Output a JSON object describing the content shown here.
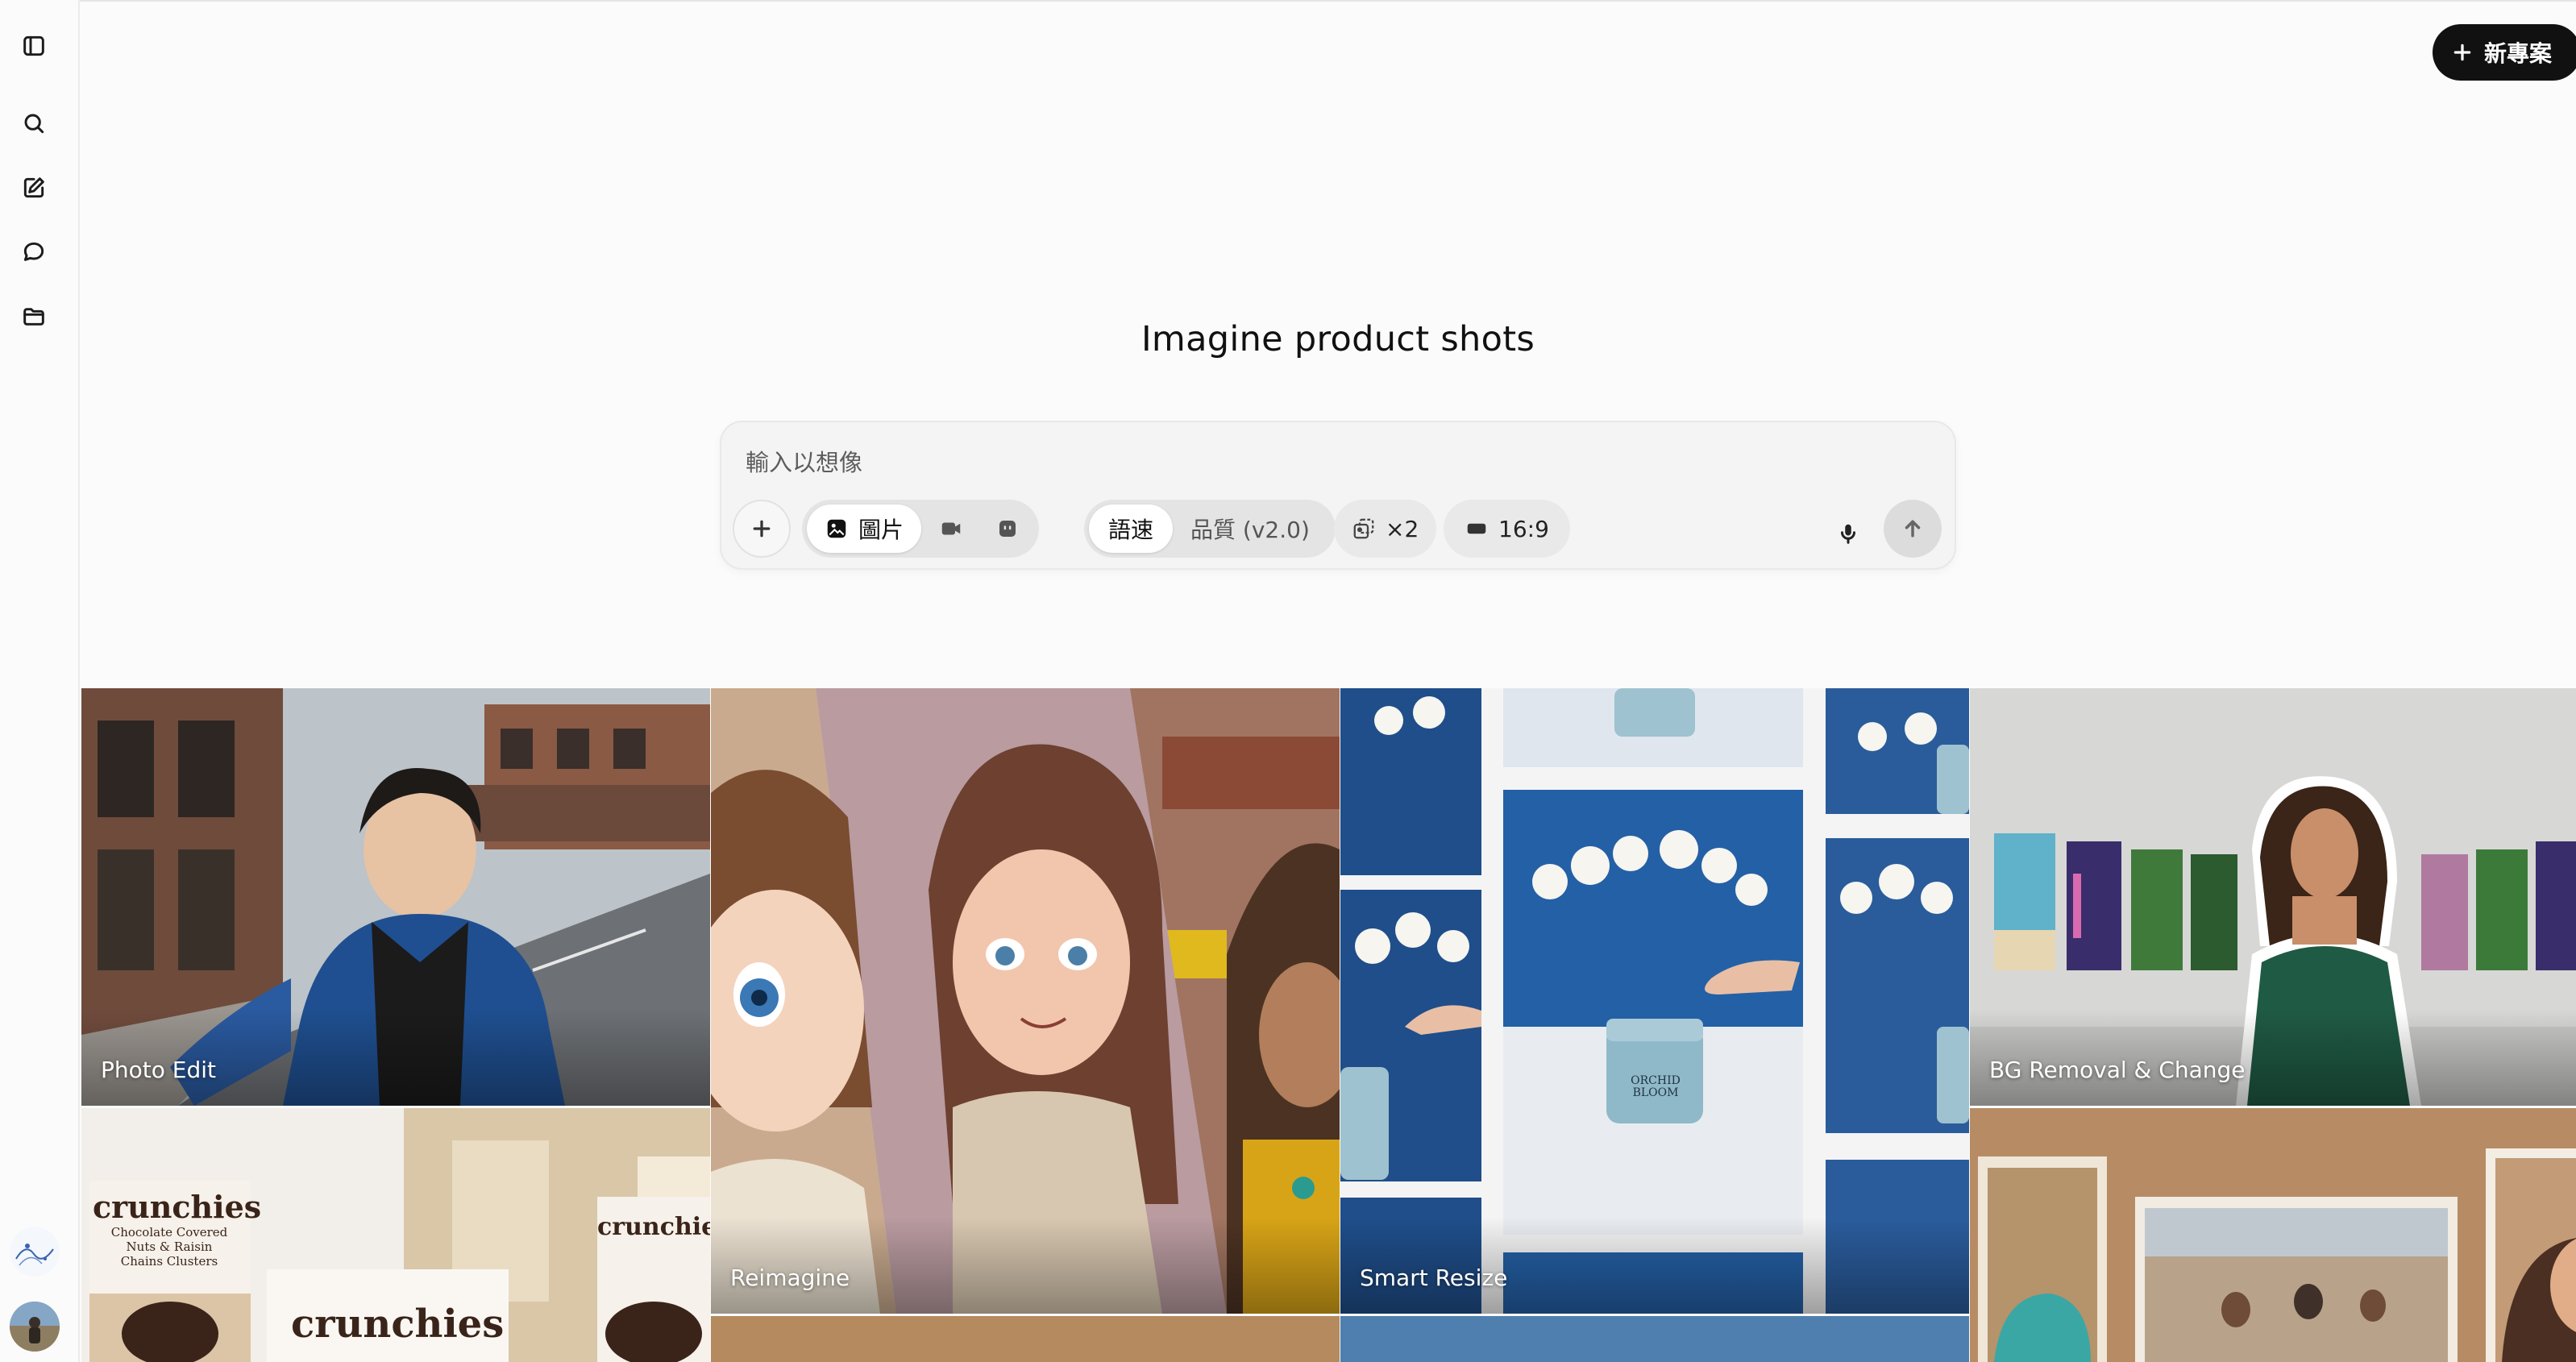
{
  "header": {
    "new_project_label": "新專案"
  },
  "hero": {
    "title": "Imagine product shots"
  },
  "composer": {
    "placeholder": "輸入以想像",
    "media_modes": [
      {
        "label": "圖片",
        "icon": "image-icon",
        "active": true
      },
      {
        "label": "",
        "icon": "video-icon",
        "active": false
      },
      {
        "label": "",
        "icon": "character-icon",
        "active": false
      }
    ],
    "speed_modes": [
      {
        "label": "語速",
        "active": true
      },
      {
        "label": "品質 (v2.0)",
        "active": false
      }
    ],
    "count_label": "×2",
    "ratio_label": "16:9"
  },
  "gallery": {
    "cards": [
      {
        "label": "Photo Edit"
      },
      {
        "label": "Reimagine"
      },
      {
        "label": "Smart Resize"
      },
      {
        "label": "BG Removal & Change"
      }
    ],
    "crunchies": {
      "brand": "crunchies",
      "desc1": "Chocolate Covered",
      "desc2": "Nuts & Raisin",
      "desc3": "Chains Clusters"
    },
    "orchid": {
      "line1": "ORCHID",
      "line2": "BLOOM"
    }
  },
  "colors": {
    "accent": "#111111",
    "background": "#fbfbfb"
  }
}
